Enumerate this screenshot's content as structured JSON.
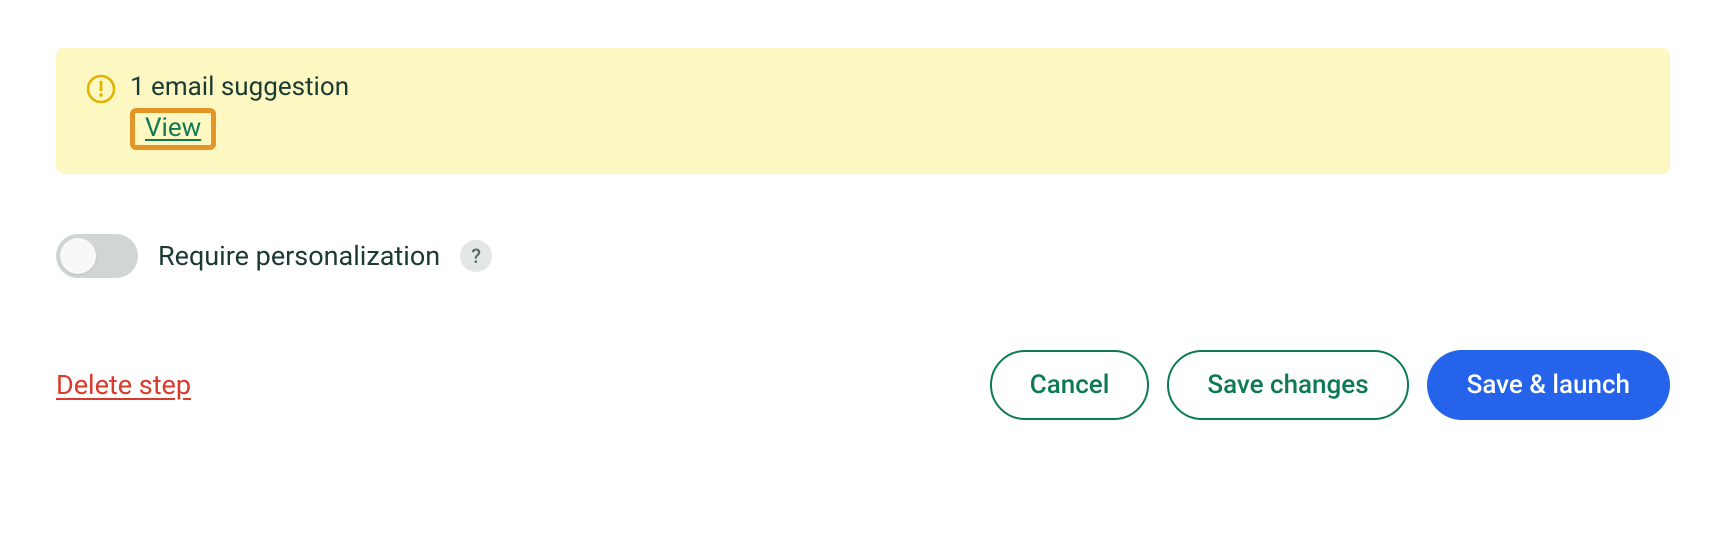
{
  "alert": {
    "title": "1 email suggestion",
    "view_label": "View"
  },
  "toggle": {
    "label": "Require personalization",
    "help_symbol": "?"
  },
  "footer": {
    "delete_label": "Delete step",
    "cancel_label": "Cancel",
    "save_label": "Save changes",
    "launch_label": "Save & launch"
  }
}
